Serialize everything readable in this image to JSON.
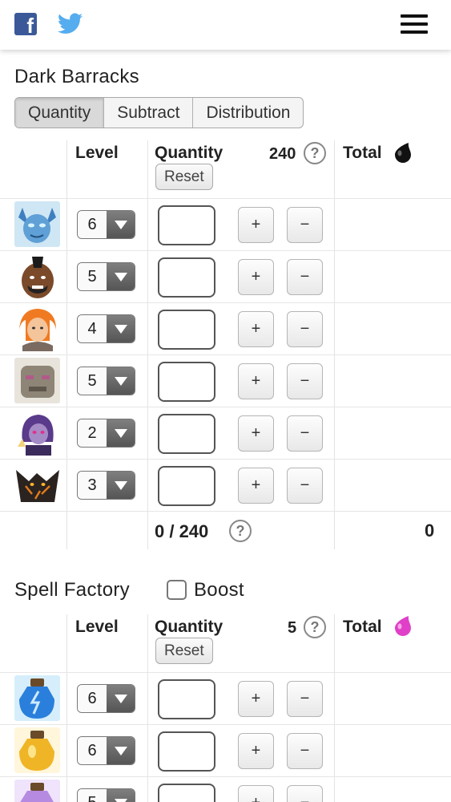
{
  "header": {
    "facebook_icon": "facebook-icon",
    "twitter_icon": "twitter-icon",
    "menu_icon": "hamburger-menu-icon"
  },
  "dark_barracks": {
    "title": "Dark Barracks",
    "tabs": [
      {
        "label": "Quantity",
        "active": true
      },
      {
        "label": "Subtract",
        "active": false
      },
      {
        "label": "Distribution",
        "active": false
      }
    ],
    "columns": {
      "level": "Level",
      "quantity": "Quantity",
      "total": "Total"
    },
    "capacity": "240",
    "reset_label": "Reset",
    "total_icon": "dark-elixir-drop-icon",
    "rows": [
      {
        "unit": "minion",
        "level": "6",
        "plus": "+",
        "minus": "−"
      },
      {
        "unit": "hog-rider",
        "level": "5",
        "plus": "+",
        "minus": "−"
      },
      {
        "unit": "valkyrie",
        "level": "4",
        "plus": "+",
        "minus": "−"
      },
      {
        "unit": "golem",
        "level": "5",
        "plus": "+",
        "minus": "−"
      },
      {
        "unit": "witch",
        "level": "2",
        "plus": "+",
        "minus": "−"
      },
      {
        "unit": "lava-hound",
        "level": "3",
        "plus": "+",
        "minus": "−"
      }
    ],
    "footer": {
      "used": "0 / 240",
      "total": "0"
    }
  },
  "spell_factory": {
    "title": "Spell Factory",
    "boost_label": "Boost",
    "boost_checked": false,
    "columns": {
      "level": "Level",
      "quantity": "Quantity",
      "total": "Total"
    },
    "capacity": "5",
    "reset_label": "Reset",
    "total_icon": "elixir-drop-icon",
    "rows": [
      {
        "unit": "lightning-spell",
        "level": "6",
        "plus": "+",
        "minus": "−"
      },
      {
        "unit": "rage-spell",
        "level": "6",
        "plus": "+",
        "minus": "−"
      },
      {
        "unit": "heal-spell",
        "level": "5",
        "plus": "+",
        "minus": "−"
      }
    ]
  },
  "colors": {
    "facebook": "#3b5998",
    "twitter": "#55acee",
    "dark_elixir": "#111111",
    "elixir": "#e040c8"
  }
}
